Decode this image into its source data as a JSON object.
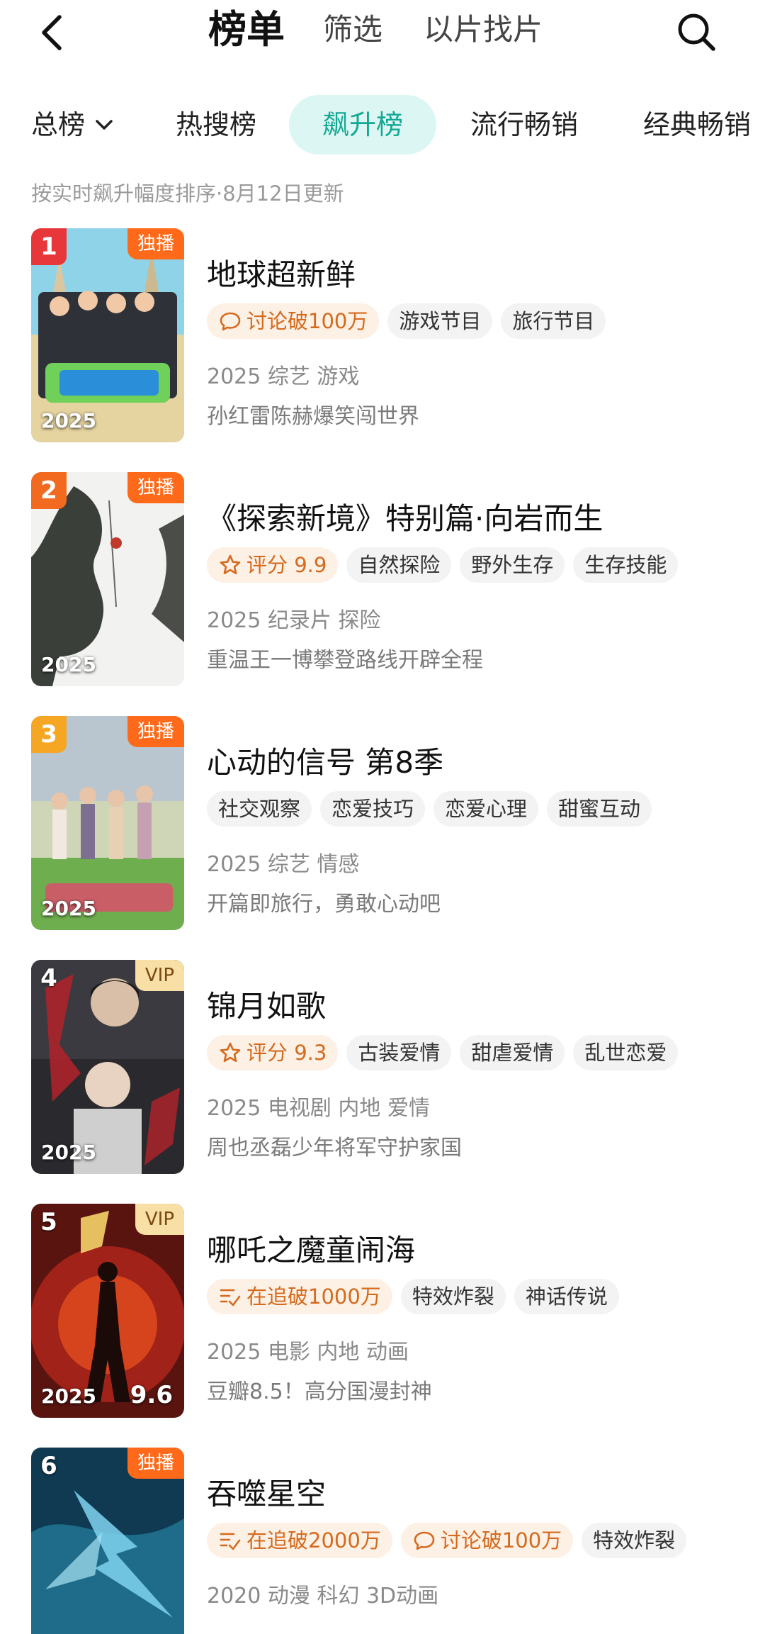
{
  "header": {
    "tabs": [
      "榜单",
      "筛选",
      "以片找片"
    ]
  },
  "categories": [
    "总榜",
    "热搜榜",
    "飙升榜",
    "流行畅销",
    "经典畅销"
  ],
  "subtitle": "按实时飙升幅度排序·8月12日更新",
  "colors": {
    "accent": "#13a893",
    "rank1": "#e8373b",
    "rank2": "#f26a1f",
    "rank3": "#f5a623",
    "exclusive_badge": "#ff6a1a",
    "vip_badge": "#f7dfa6"
  },
  "items": [
    {
      "rank": "1",
      "badge": "独播",
      "poster_year": "2025",
      "title": "地球超新鲜",
      "tags": [
        {
          "label": "讨论破100万",
          "icon": "chat-bubble-icon"
        },
        {
          "label": "游戏节目"
        },
        {
          "label": "旅行节目"
        }
      ],
      "meta": "2025 综艺 游戏",
      "desc": "孙红雷陈赫爆笑闯世界"
    },
    {
      "rank": "2",
      "badge": "独播",
      "poster_year": "2025",
      "title": "《探索新境》特别篇·向岩而生",
      "tags": [
        {
          "label": "评分 9.9",
          "icon": "star-icon"
        },
        {
          "label": "自然探险"
        },
        {
          "label": "野外生存"
        },
        {
          "label": "生存技能"
        }
      ],
      "meta": "2025 纪录片 探险",
      "desc": "重温王一博攀登路线开辟全程"
    },
    {
      "rank": "3",
      "badge": "独播",
      "poster_year": "2025",
      "title": "心动的信号 第8季",
      "tags": [
        {
          "label": "社交观察"
        },
        {
          "label": "恋爱技巧"
        },
        {
          "label": "恋爱心理"
        },
        {
          "label": "甜蜜互动"
        }
      ],
      "meta": "2025 综艺 情感",
      "desc": "开篇即旅行，勇敢心动吧"
    },
    {
      "rank": "4",
      "badge": "VIP",
      "poster_year": "2025",
      "title": "锦月如歌",
      "tags": [
        {
          "label": "评分 9.3",
          "icon": "star-icon"
        },
        {
          "label": "古装爱情"
        },
        {
          "label": "甜虐爱情"
        },
        {
          "label": "乱世恋爱"
        }
      ],
      "meta": "2025 电视剧 内地 爱情",
      "desc": "周也丞磊少年将军守护家国"
    },
    {
      "rank": "5",
      "badge": "VIP",
      "poster_year": "2025",
      "poster_score": "9.6",
      "title": "哪吒之魔童闹海",
      "tags": [
        {
          "label": "在追破1000万",
          "icon": "trending-list-icon"
        },
        {
          "label": "特效炸裂"
        },
        {
          "label": "神话传说"
        }
      ],
      "meta": "2025 电影 内地 动画",
      "desc": "豆瓣8.5！高分国漫封神"
    },
    {
      "rank": "6",
      "badge": "独播",
      "poster_year": "",
      "title": "吞噬星空",
      "tags": [
        {
          "label": "在追破2000万",
          "icon": "trending-list-icon"
        },
        {
          "label": "讨论破100万",
          "icon": "chat-bubble-icon"
        },
        {
          "label": "特效炸裂"
        }
      ],
      "meta": "2020 动漫 科幻 3D动画",
      "desc": ""
    }
  ]
}
